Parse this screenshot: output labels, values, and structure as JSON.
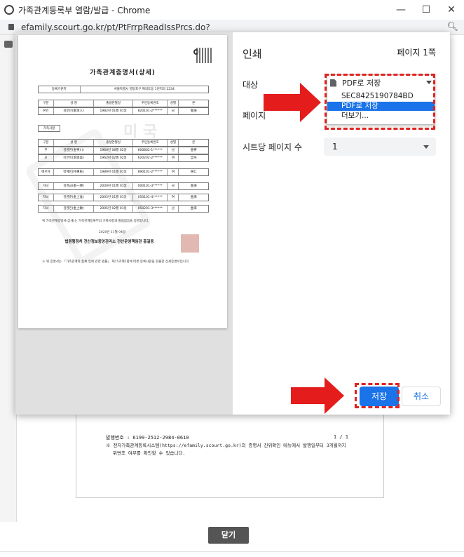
{
  "window": {
    "title": "가족관계등록부 열람/발급 - Chrome",
    "minimize": "—",
    "maximize": "☐",
    "close": "✕"
  },
  "address": {
    "url": "efamily.scourt.go.kr/pt/PtFrrpReadIssPrcs.do?"
  },
  "preview": {
    "doc_title": "가족관계증명서(상세)",
    "watermark": "미 국",
    "rows": [
      [
        "구분",
        "성 명",
        "출생연월일",
        "주민등록번호",
        "성별",
        "본"
      ],
      [
        "본인",
        "김분단(金本人)",
        "1982년 01월 01일",
        "820101-2******",
        "남",
        "金海"
      ],
      [
        "구분",
        "성 명",
        "출생연월일",
        "주민등록번호",
        "성별",
        "본"
      ],
      [
        "부",
        "김영천(金寧川)",
        "1960년 08월 02일",
        "600802-1******",
        "남",
        "金寧"
      ],
      [
        "모",
        "이은미(李恩美)",
        "1962년 02월 02일",
        "620202-2******",
        "여",
        "全州"
      ],
      [
        "배우자",
        "박혜민(朴惠民)",
        "1989년 01월 01일",
        "890101-2******",
        "여",
        "陝仁"
      ],
      [
        "자녀",
        "김영금(金一瑛)",
        "2000년 01월 01일",
        "000101-3******",
        "남",
        "金海"
      ],
      [
        "자녀",
        "김영준(金上准)",
        "2005년 01월 01일",
        "050101-4******",
        "여",
        "金海"
      ],
      [
        "자녀",
        "김영민(金上敏)",
        "2005년 02월 01일",
        "050201-3******",
        "남",
        "金海"
      ]
    ],
    "section_label": "가족사항",
    "reg_label": "등록기준지",
    "reg_value": "서울특별시 영등포구 여의도동 1번지의 1234",
    "cert_text": "위 가족관계증명서(상세)는 가족관계등록부의 기록사항과 틀림없음을 증명합니다.",
    "date_text": "2020년 11월 04일",
    "issuer": "법원행정처 전산정보중앙관리소 전산운영책임관 홍길동",
    "note": "※ 위 증명서는 「가족관계의 등록 등에 관한 법률」 제15조제2항에 따른 등록사항을 현출한 상세증명서입니다."
  },
  "panel": {
    "title": "인쇄",
    "page_count": "페이지 1쪽",
    "destination_label": "대상",
    "destination_value": "PDF로 저장",
    "pages_label": "페이지",
    "sheets_label": "시트당 페이지 수",
    "sheets_value": "1",
    "dropdown_items": [
      "SEC8425190784BD",
      "PDF로 저장",
      "더보기..."
    ],
    "save_label": "저장",
    "cancel_label": "취소"
  },
  "background_doc": {
    "issue_no": "발행번호 : 6199-2512-2984-0610",
    "page": "1 / 1",
    "note1": "※ 전자가족관계등록시스템(https://efamily.scourt.go.kr)의 증명서 진위확인 메뉴에서 발행일부터 3개월까지",
    "note2": "위변조 여부를 확인할 수 있습니다."
  },
  "footer": {
    "close_label": "닫기"
  },
  "colors": {
    "accent": "#1a73e8",
    "annotation": "#e0221f"
  }
}
